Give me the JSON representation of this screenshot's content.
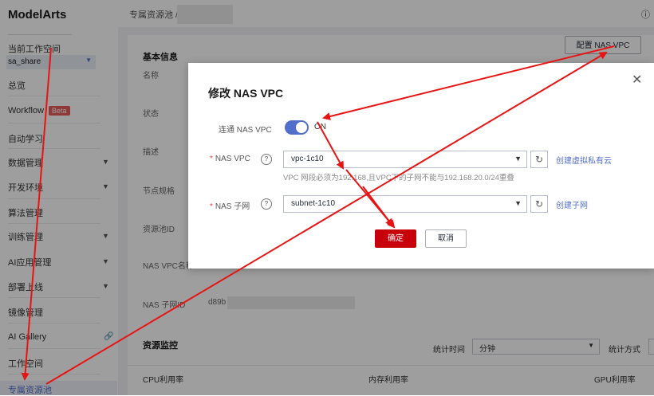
{
  "sidebar": {
    "brand": "ModelArts",
    "workspace_label": "当前工作空间",
    "workspace_value": "sa_share",
    "items": [
      {
        "label": "总览"
      },
      {
        "label": "Workflow",
        "badge": "Beta"
      },
      {
        "label": "自动学习"
      },
      {
        "label": "数据管理"
      },
      {
        "label": "开发环境"
      },
      {
        "label": "算法管理"
      },
      {
        "label": "训练管理"
      },
      {
        "label": "AI应用管理"
      },
      {
        "label": "部署上线"
      },
      {
        "label": "镜像管理"
      },
      {
        "label": "AI Gallery"
      },
      {
        "label": "工作空间"
      },
      {
        "label": "专属资源池"
      }
    ]
  },
  "header": {
    "breadcrumb": "专属资源池 /",
    "right_text": "ⓘ"
  },
  "main": {
    "section_basic": "基本信息",
    "config_button": "配置 NAS VPC",
    "fields": [
      "名称",
      "状态",
      "描述",
      "节点规格",
      "资源池ID",
      "NAS VPC名称",
      "NAS 子网ID"
    ],
    "subnet_value": "d89b",
    "section_monitor": "资源监控",
    "stat_time_label": "统计时间",
    "stat_time_value": "分钟",
    "stat_method_label": "统计方式",
    "columns": [
      "CPU利用率",
      "内存利用率",
      "GPU利用率"
    ]
  },
  "modal": {
    "title": "修改 NAS VPC",
    "connect_label": "连通 NAS VPC",
    "toggle_text": "ON",
    "vpc_label": "NAS VPC",
    "vpc_value": "vpc-1c10",
    "vpc_link": "创建虚拟私有云",
    "hint": "VPC 网段必须为192.168,且VPC下的子网不能与192.168.20.0/24重叠",
    "subnet_label": "NAS 子网",
    "subnet_value": "subnet-1c10",
    "subnet_link": "创建子网",
    "ok": "确定",
    "cancel": "取消"
  },
  "colors": {
    "accent": "#526ecc",
    "primary_button": "#c7000b",
    "annotation_arrow": "#e81313"
  }
}
